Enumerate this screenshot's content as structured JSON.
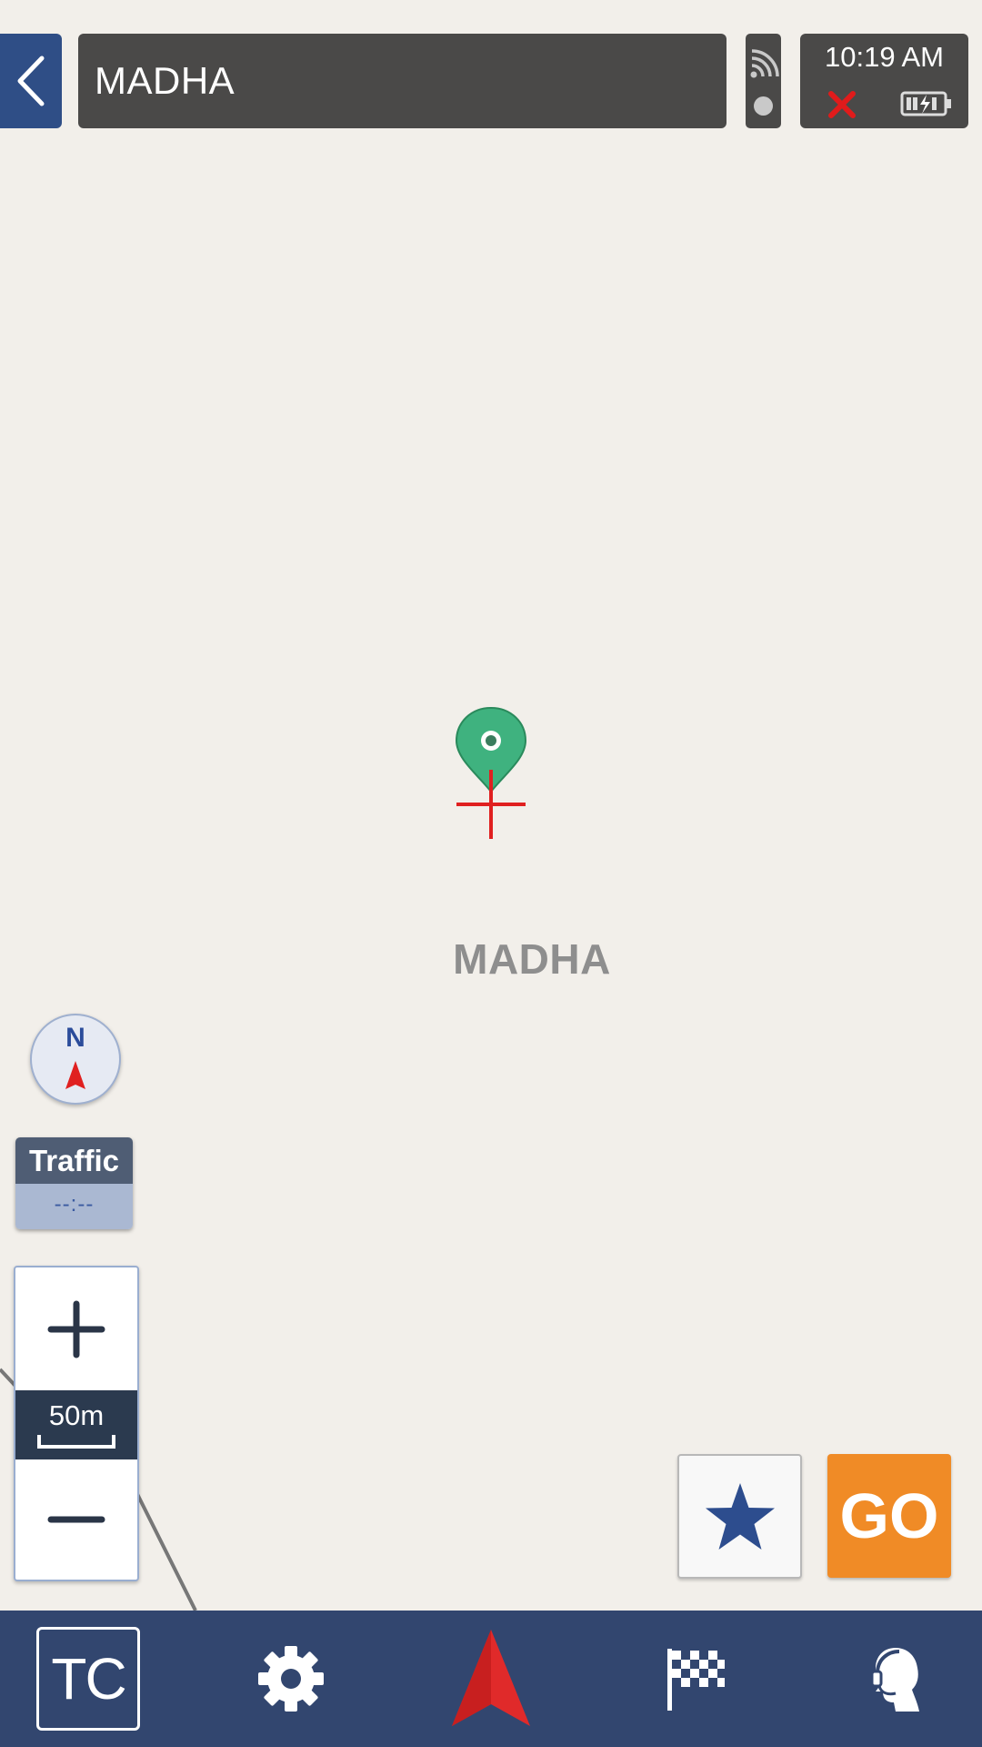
{
  "header": {
    "title": "MADHA",
    "time": "10:19 AM"
  },
  "map": {
    "place_label": "MADHA"
  },
  "compass": {
    "label": "N"
  },
  "traffic": {
    "label": "Traffic",
    "value": "--:--"
  },
  "zoom": {
    "scale_label": "50m"
  },
  "actions": {
    "go_label": "GO"
  },
  "bottom_nav": {
    "tc_label": "TC"
  },
  "icons": {
    "back": "chevron-left-icon",
    "gps": "gps-signal-icon",
    "no_connection": "close-icon",
    "battery": "battery-charging-icon",
    "pin": "map-pin-icon",
    "crosshair": "crosshair-icon",
    "favorite": "star-icon",
    "settings": "gear-icon",
    "navigate": "navigation-arrow-icon",
    "destination": "checkered-flag-icon",
    "support": "headset-support-icon"
  },
  "colors": {
    "accent_go": "#f08b26",
    "nav_bar": "#32466f",
    "back_button": "#2f4e86",
    "pin_green": "#3fb27f",
    "crosshair_red": "#e02020"
  }
}
